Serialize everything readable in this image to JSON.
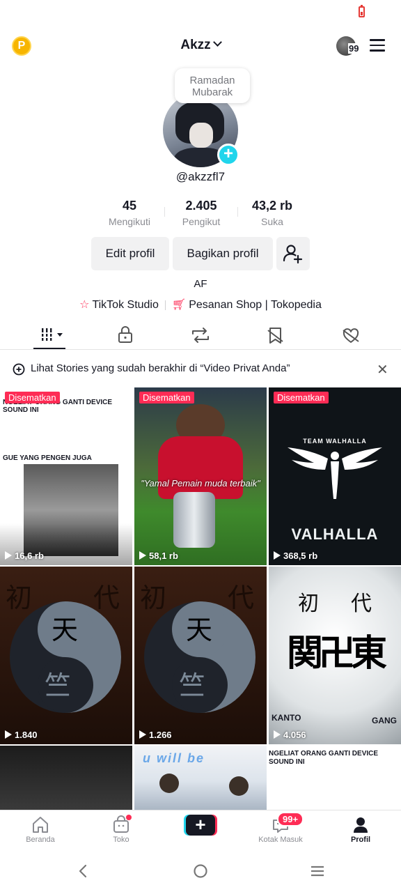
{
  "header": {
    "username": "Akzz",
    "mini_badge": "99"
  },
  "profile": {
    "note": "Ramadan Mubarak",
    "handle": "@akzzfl7",
    "stats": [
      {
        "value": "45",
        "label": "Mengikuti"
      },
      {
        "value": "2.405",
        "label": "Pengikut"
      },
      {
        "value": "43,2 rb",
        "label": "Suka"
      }
    ],
    "edit_label": "Edit profil",
    "share_label": "Bagikan profil",
    "bio": "AF",
    "link_studio": "TikTok Studio",
    "link_shop": "Pesanan Shop | Tokopedia"
  },
  "stories_notice": "Lihat Stories yang sudah berakhir di “Video Privat Anda”",
  "videos": [
    {
      "pinned": "Disematkan",
      "views": "16,6 rb",
      "caption_top": "NGELIAT ORANG GANTI DEVICE SOUND INI",
      "caption_mid": "GUE YANG PENGEN JUGA"
    },
    {
      "pinned": "Disematkan",
      "views": "58,1 rb",
      "caption_mid": "\"Yamal Pemain muda terbaik\""
    },
    {
      "pinned": "Disematkan",
      "views": "368,5 rb",
      "caption_top": "TEAM WALHALLA",
      "caption_bottom": "VALHALLA"
    },
    {
      "views": "1.840",
      "glyphs": [
        "初",
        "代",
        "天",
        "竺"
      ]
    },
    {
      "views": "1.266",
      "glyphs": [
        "初",
        "代",
        "天",
        "竺"
      ]
    },
    {
      "views": "4.056",
      "glyphs": [
        "初",
        "代",
        "関卍東"
      ],
      "caption_left": "KANTO",
      "caption_right": "GANG"
    },
    {
      "views": ""
    },
    {
      "views": "",
      "caption_top": "u will be"
    },
    {
      "views": "",
      "caption_top": "NGELIAT ORANG GANTI DEVICE SOUND INI"
    }
  ],
  "bottom_nav": [
    {
      "label": "Beranda"
    },
    {
      "label": "Toko"
    },
    {
      "label": ""
    },
    {
      "label": "Kotak Masuk",
      "badge": "99+"
    },
    {
      "label": "Profil"
    }
  ],
  "colors": {
    "accent": "#fe2c55",
    "cyan": "#20d5ec",
    "text": "#161823",
    "muted": "#8a8b91"
  }
}
